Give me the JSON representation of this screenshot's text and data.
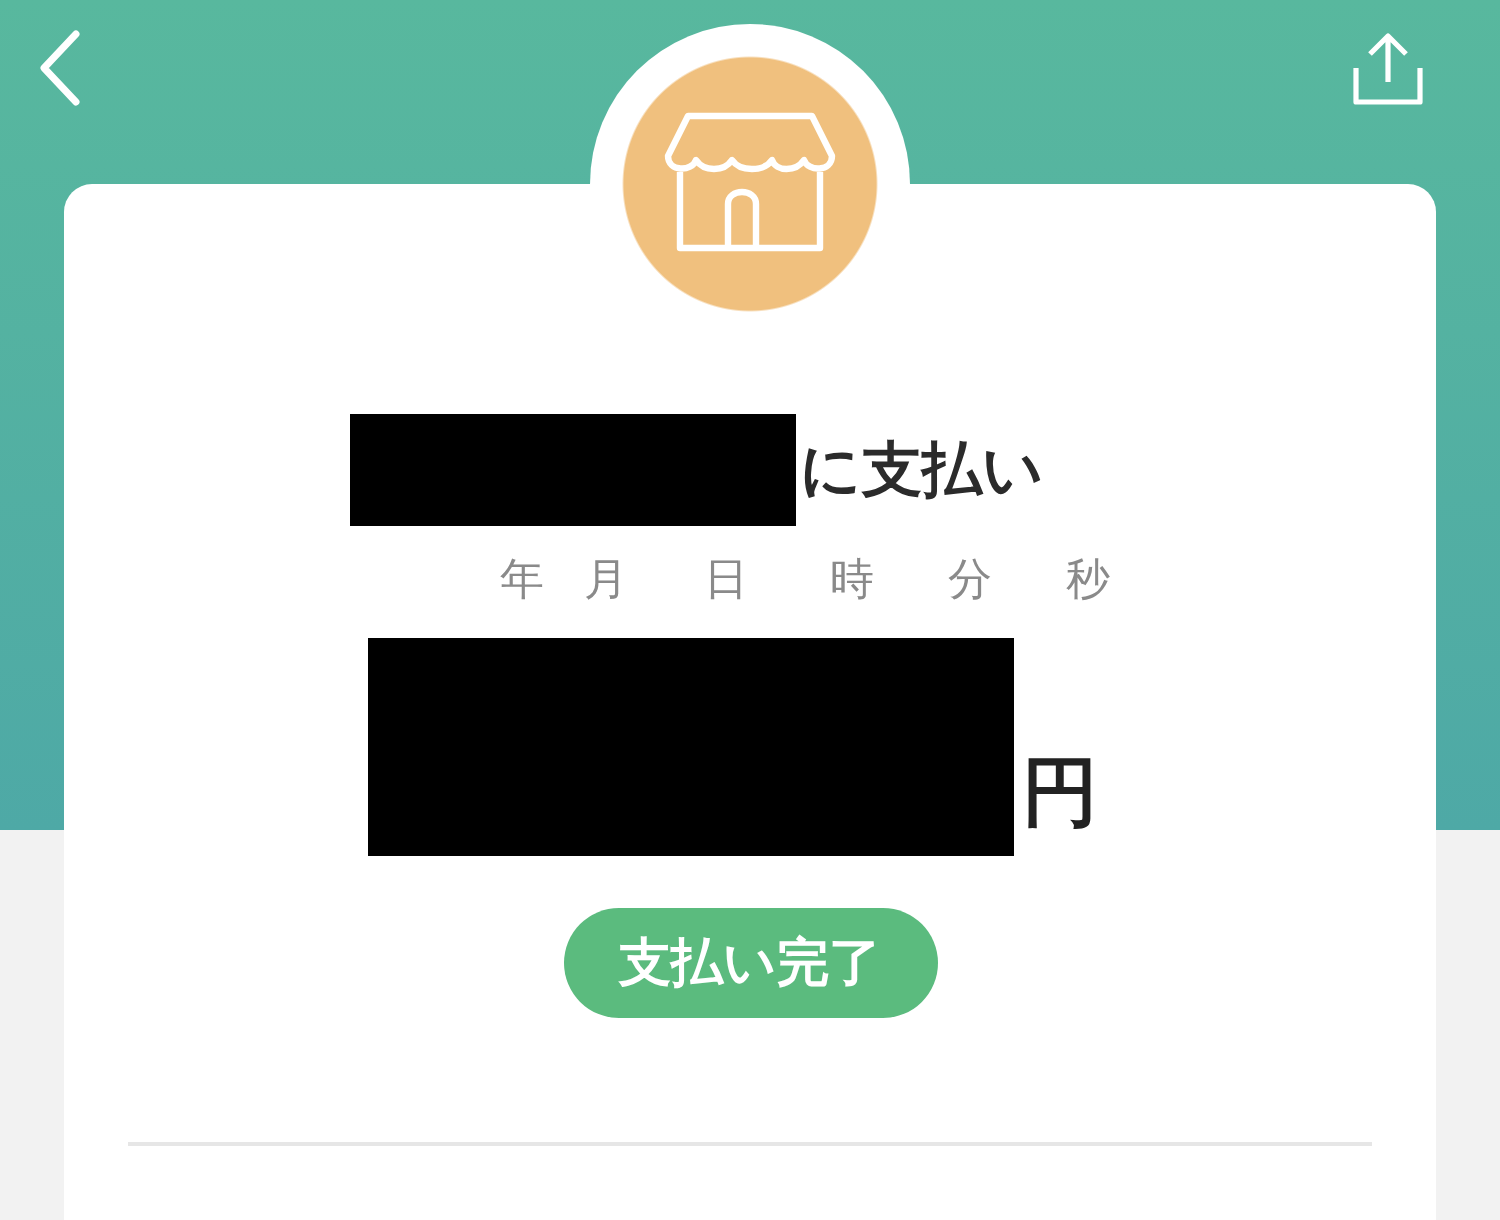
{
  "payment": {
    "merchant": {
      "redacted": true
    },
    "title_suffix": "に支払い",
    "datetime_units": [
      "年",
      "月",
      "日",
      "時",
      "分",
      "秒"
    ],
    "amount": {
      "redacted": true,
      "unit": "円"
    },
    "status": {
      "label": "支払い完了"
    }
  }
}
